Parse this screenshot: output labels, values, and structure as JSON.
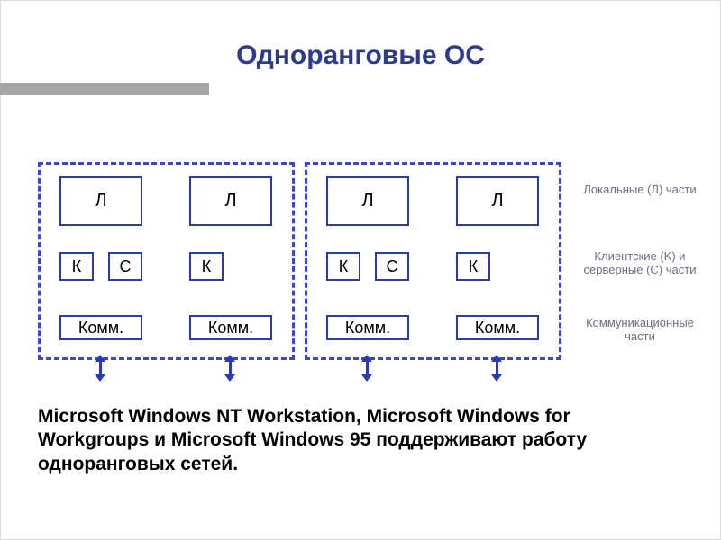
{
  "title": "Одноранговые ОС",
  "groups": {
    "left": {
      "nodes": [
        {
          "L": "Л",
          "K": "К",
          "C": "С",
          "comm": "Комм."
        },
        {
          "L": "Л",
          "K": "К",
          "C": null,
          "comm": "Комм."
        }
      ]
    },
    "right": {
      "nodes": [
        {
          "L": "Л",
          "K": "К",
          "C": "С",
          "comm": "Комм."
        },
        {
          "L": "Л",
          "K": "К",
          "C": null,
          "comm": "Комм."
        }
      ]
    }
  },
  "legend": {
    "local": "Локальные (Л) части",
    "client_server": "Клиентские (K) и серверные (C) части",
    "comm": "Коммуникационные части"
  },
  "caption": "Microsoft Windows NT Workstation, Microsoft Windows for Workgroups и Microsoft Windows 95 поддерживают работу одноранговых сетей."
}
